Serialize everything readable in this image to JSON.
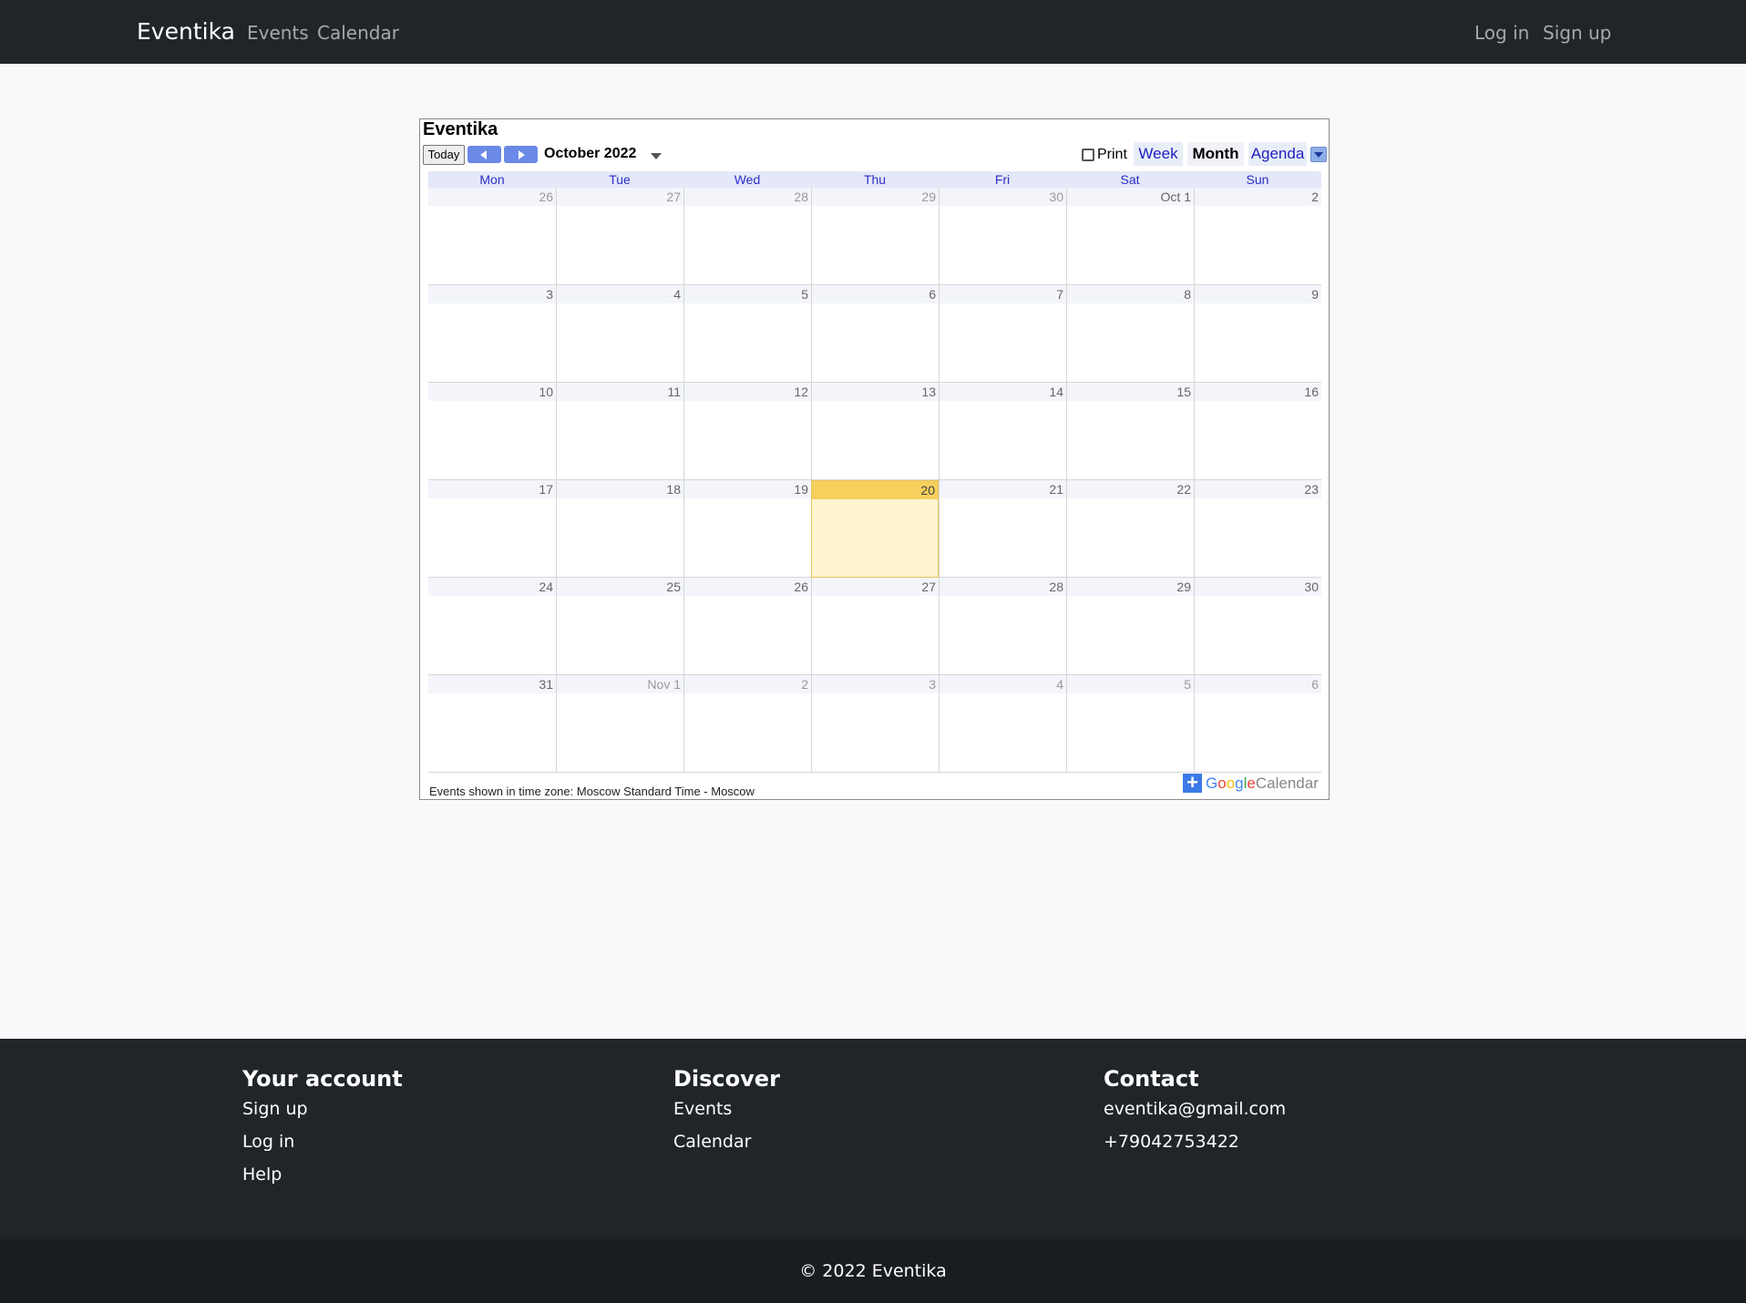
{
  "navbar": {
    "brand": "Eventika",
    "links": [
      "Events",
      "Calendar"
    ],
    "login": "Log in",
    "signup": "Sign up"
  },
  "calendar": {
    "title": "Eventika",
    "today_label": "Today",
    "month_label": "October 2022",
    "print_label": "Print",
    "tabs": [
      "Week",
      "Month",
      "Agenda"
    ],
    "active_tab": "Month",
    "days_of_week": [
      "Mon",
      "Tue",
      "Wed",
      "Thu",
      "Fri",
      "Sat",
      "Sun"
    ],
    "weeks": [
      [
        "26",
        "27",
        "28",
        "29",
        "30",
        "Oct 1",
        "2"
      ],
      [
        "3",
        "4",
        "5",
        "6",
        "7",
        "8",
        "9"
      ],
      [
        "10",
        "11",
        "12",
        "13",
        "14",
        "15",
        "16"
      ],
      [
        "17",
        "18",
        "19",
        "20",
        "21",
        "22",
        "23"
      ],
      [
        "24",
        "25",
        "26",
        "27",
        "28",
        "29",
        "30"
      ],
      [
        "31",
        "Nov 1",
        "2",
        "3",
        "4",
        "5",
        "6"
      ]
    ],
    "today_date": "20",
    "timezone_note": "Events shown in time zone: Moscow Standard Time - Moscow",
    "badge_google": "Google",
    "badge_calendar": "Calendar"
  },
  "footer": {
    "account": {
      "heading": "Your account",
      "links": [
        "Sign up",
        "Log in",
        "Help"
      ]
    },
    "discover": {
      "heading": "Discover",
      "links": [
        "Events",
        "Calendar"
      ]
    },
    "contact": {
      "heading": "Contact",
      "email": "eventika@gmail.com",
      "phone": "+79042753422"
    },
    "copyright": "© 2022 Eventika"
  },
  "colors": {
    "navbar_bg": "#212529",
    "page_bg": "#f8f9fa",
    "today_bg": "#f6cf5c",
    "accent_blue": "#6b89e6",
    "link_blue": "#2d2dc8"
  }
}
